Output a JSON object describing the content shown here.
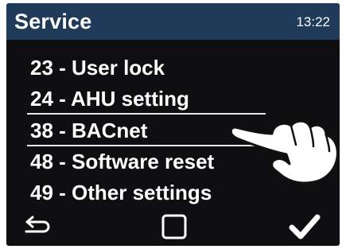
{
  "header": {
    "title": "Service",
    "time": "13:22"
  },
  "menu": {
    "items": [
      {
        "label": "23 - User lock"
      },
      {
        "label": "24 - AHU setting"
      },
      {
        "label": "38 - BACnet"
      },
      {
        "label": "48 - Software reset"
      },
      {
        "label": "49 - Other settings"
      }
    ],
    "selected_index": 2
  },
  "bottom_bar": {
    "back_icon": "back-arrow-icon",
    "home_icon": "square-icon",
    "confirm_icon": "checkmark-icon"
  },
  "overlay": {
    "pointer_icon": "pointing-hand-icon"
  },
  "colors": {
    "header_bg": "#203a5a",
    "screen_bg": "#0f0f12",
    "text": "#ffffff"
  }
}
